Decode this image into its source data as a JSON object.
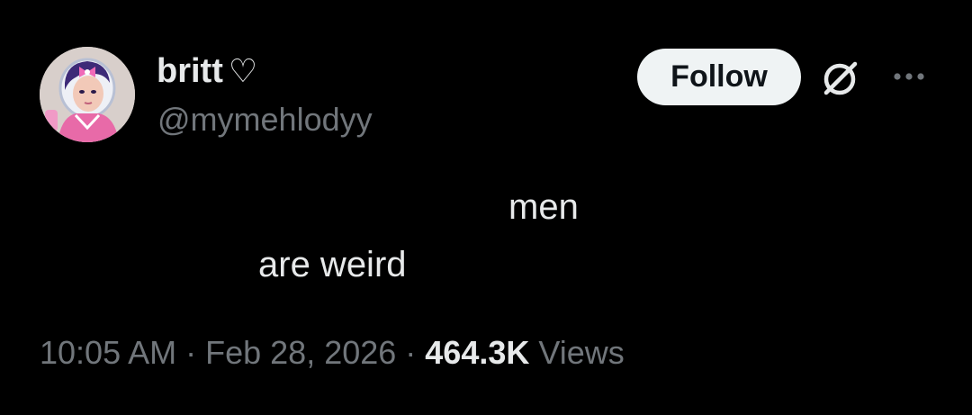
{
  "author": {
    "display_name": "britt",
    "name_emoji": "♡",
    "handle": "@mymehlodyy",
    "avatar_icon": "profile-avatar-character"
  },
  "actions": {
    "follow_label": "Follow",
    "grok_icon": "grok-icon",
    "more_icon": "more-options-icon"
  },
  "tweet": {
    "line1": "men",
    "line2": "are weird"
  },
  "meta": {
    "time": "10:05 AM",
    "separator": " · ",
    "date": "Feb 28, 2026",
    "views_count": "464.3K",
    "views_label": "Views"
  },
  "colors": {
    "background": "#000000",
    "primary_text": "#e7e9ea",
    "secondary_text": "#71767b",
    "follow_bg": "#eff3f4"
  }
}
